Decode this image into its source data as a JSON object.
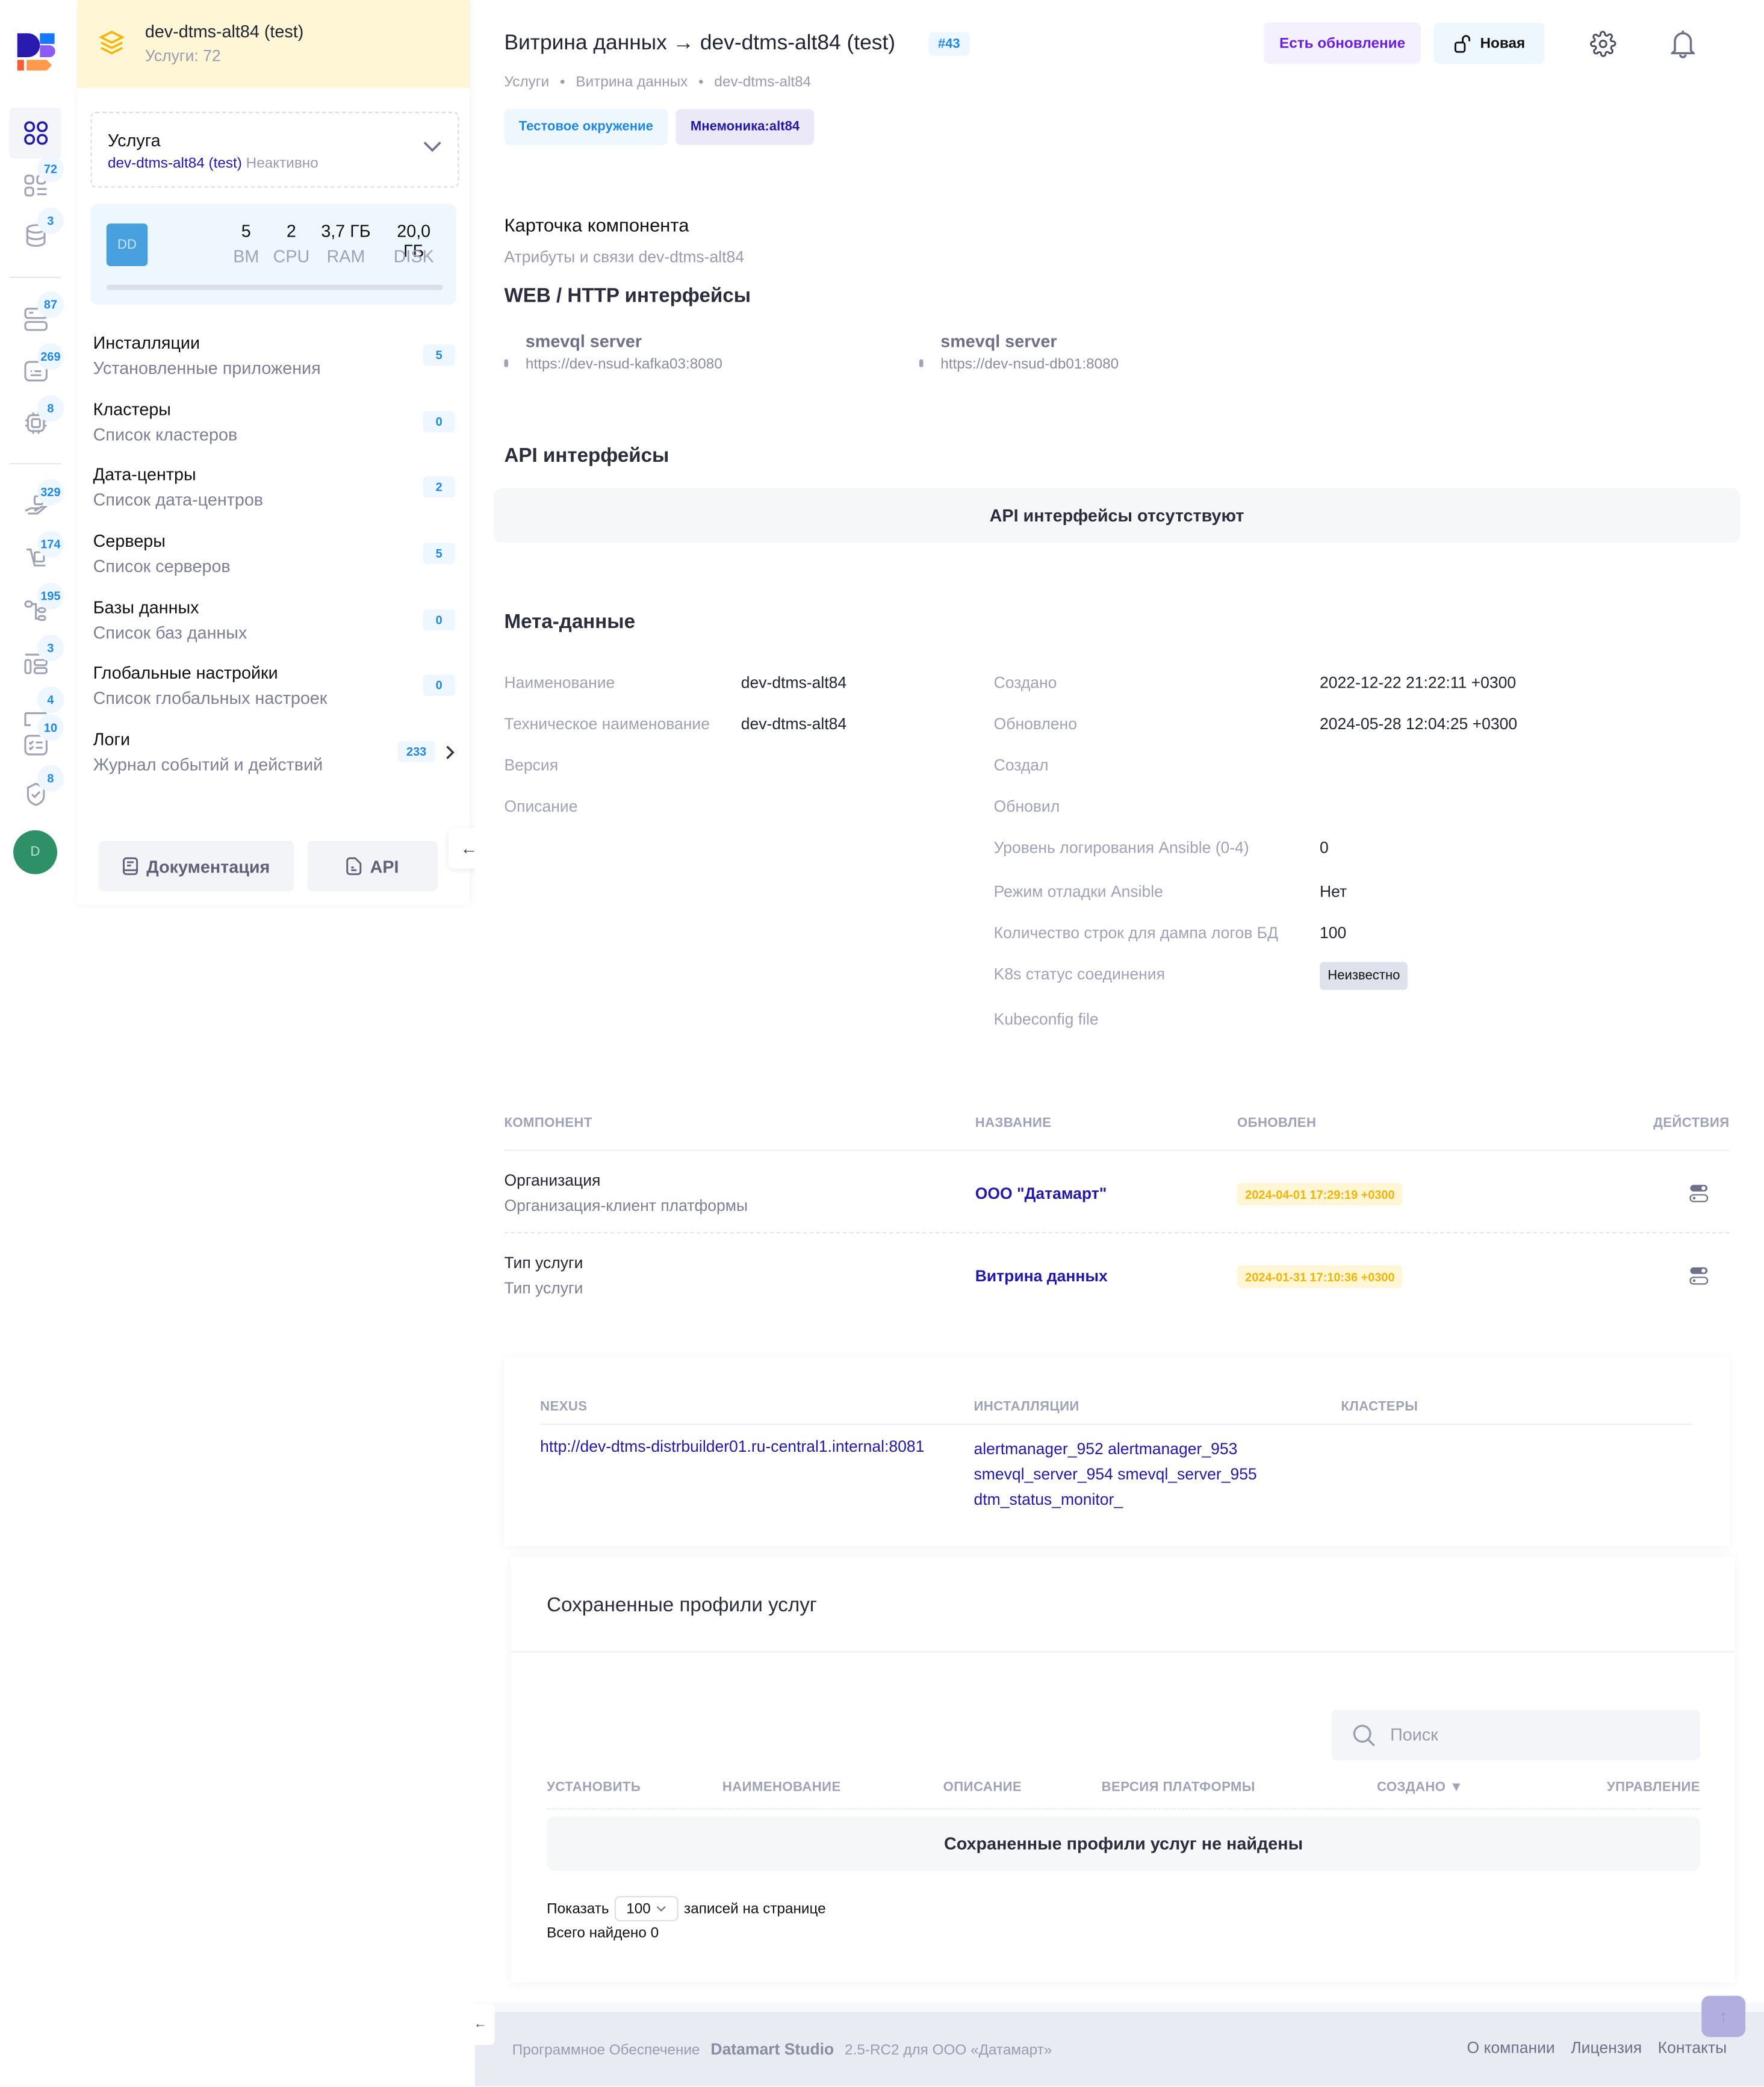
{
  "rail": {
    "items": [
      {
        "icon": "grid-icon",
        "badge": null,
        "active": true
      },
      {
        "icon": "services-list-icon",
        "badge": "72"
      },
      {
        "icon": "database-icon",
        "badge": "3"
      },
      {
        "icon": "server-rack-icon",
        "badge": "87"
      },
      {
        "icon": "terminal-icon",
        "badge": "269"
      },
      {
        "icon": "cpu-chip-icon",
        "badge": "8"
      },
      {
        "icon": "hand-box-icon",
        "badge": "329"
      },
      {
        "icon": "delivery-cart-icon",
        "badge": "174"
      },
      {
        "icon": "tree-structure-icon",
        "badge": "195"
      },
      {
        "icon": "layout-blocks-icon",
        "badge": "3"
      },
      {
        "icon": "card-stack-icon",
        "badge": "4"
      },
      {
        "icon": "checklist-icon",
        "badge": "10"
      },
      {
        "icon": "shield-check-icon",
        "badge": "8"
      }
    ],
    "avatar": "D"
  },
  "panel": {
    "title": "dev-dtms-alt84 (test)",
    "subtitle": "Услуги: 72",
    "service_select": {
      "label": "Услуга",
      "value": "dev-dtms-alt84 (test)",
      "status": "Неактивно"
    },
    "resources": {
      "avatar": "DD",
      "stats": [
        {
          "value": "5",
          "label": "ВМ"
        },
        {
          "value": "2",
          "label": "CPU"
        },
        {
          "value": "3,7 ГБ",
          "label": "RAM"
        },
        {
          "value": "20,0 ГБ",
          "label": "DISK"
        }
      ]
    },
    "nav": [
      {
        "title": "Инсталляции",
        "subtitle": "Установленные приложения",
        "count": "5"
      },
      {
        "title": "Кластеры",
        "subtitle": "Список кластеров",
        "count": "0"
      },
      {
        "title": "Дата-центры",
        "subtitle": "Список дата-центров",
        "count": "2"
      },
      {
        "title": "Серверы",
        "subtitle": "Список серверов",
        "count": "5"
      },
      {
        "title": "Базы данных",
        "subtitle": "Список баз данных",
        "count": "0"
      },
      {
        "title": "Глобальные настройки",
        "subtitle": "Список глобальных настроек",
        "count": "0"
      },
      {
        "title": "Логи",
        "subtitle": "Журнал событий и действий",
        "count": "233"
      }
    ],
    "docs_label": "Документация",
    "api_label": "API"
  },
  "header": {
    "title": "Витрина данных → dev-dtms-alt84 (test)",
    "id_badge": "#43",
    "breadcrumbs": [
      "Услуги",
      "Витрина данных",
      "dev-dtms-alt84"
    ],
    "tags": [
      "Тестовое окружение",
      "Мнемоника:alt84"
    ],
    "update_label": "Есть обновление",
    "status_label": "Новая"
  },
  "card": {
    "title": "Карточка компонента",
    "subtitle": "Атрибуты и связи dev-dtms-alt84",
    "web_title": "WEB / HTTP интерфейсы",
    "web": [
      {
        "name": "smevql server",
        "url": "https://dev-nsud-kafka03:8080"
      },
      {
        "name": "smevql server",
        "url": "https://dev-nsud-db01:8080"
      }
    ],
    "api_title": "API интерфейсы",
    "api_empty": "API интерфейсы отсутствуют",
    "meta_title": "Мета-данные",
    "meta_left": [
      {
        "label": "Наименование",
        "value": "dev-dtms-alt84"
      },
      {
        "label": "Техническое наименование",
        "value": "dev-dtms-alt84"
      },
      {
        "label": "Версия",
        "value": ""
      },
      {
        "label": "Описание",
        "value": ""
      }
    ],
    "meta_right": [
      {
        "label": "Создано",
        "value": "2022-12-22 21:22:11 +0300"
      },
      {
        "label": "Обновлено",
        "value": "2024-05-28 12:04:25 +0300"
      },
      {
        "label": "Создал",
        "value": ""
      },
      {
        "label": "Обновил",
        "value": ""
      },
      {
        "label": "Уровень логирования Ansible (0-4)",
        "value": "0"
      },
      {
        "label": "Режим отладки Ansible",
        "value": "Нет"
      },
      {
        "label": "Количество строк для дампа логов БД",
        "value": "100"
      },
      {
        "label": "K8s статус соединения",
        "value": "Неизвестно",
        "badge": true
      },
      {
        "label": "Kubeconfig file",
        "value": ""
      }
    ]
  },
  "relations": {
    "headers": [
      "КОМПОНЕНТ",
      "НАЗВАНИЕ",
      "ОБНОВЛЕН",
      "ДЕЙСТВИЯ"
    ],
    "rows": [
      {
        "component": "Организация",
        "description": "Организация-клиент платформы",
        "name": "ООО \"Датамарт\"",
        "updated": "2024-04-01 17:29:19 +0300"
      },
      {
        "component": "Тип услуги",
        "description": "Тип услуги",
        "name": "Витрина данных",
        "updated": "2024-01-31 17:10:36 +0300"
      }
    ]
  },
  "links": {
    "headers": [
      "NEXUS",
      "ИНСТАЛЛЯЦИИ",
      "КЛАСТЕРЫ"
    ],
    "nexus": "http://dev-dtms-distrbuilder01.ru-central1.internal:8081",
    "installations": [
      "alertmanager_952",
      "alertmanager_953",
      "smevql_server_954",
      "smevql_server_955",
      "dtm_status_monitor_"
    ]
  },
  "profiles": {
    "title": "Сохраненные профили услуг",
    "search_placeholder": "Поиск",
    "headers": [
      "УСТАНОВИТЬ",
      "НАИМЕНОВАНИЕ",
      "ОПИСАНИЕ",
      "ВЕРСИЯ ПЛАТФОРМЫ",
      "СОЗДАНО",
      "УПРАВЛЕНИЕ"
    ],
    "empty": "Сохраненные профили услуг не найдены",
    "show_label": "Показать",
    "page_size": "100",
    "per_page_label": "записей на странице",
    "total": "Всего найдено 0"
  },
  "footer": {
    "prefix": "Программное Обеспечение",
    "product": "Datamart Studio",
    "version": "2.5-RC2 для ООО «Датамарт»",
    "links": [
      "О компании",
      "Лицензия",
      "Контакты"
    ]
  },
  "colors": {
    "accent": "#1e88e5",
    "link": "#2319a8",
    "update": "#6a1ee0",
    "warning": "#f5b400",
    "avatar": "#2e9066"
  }
}
